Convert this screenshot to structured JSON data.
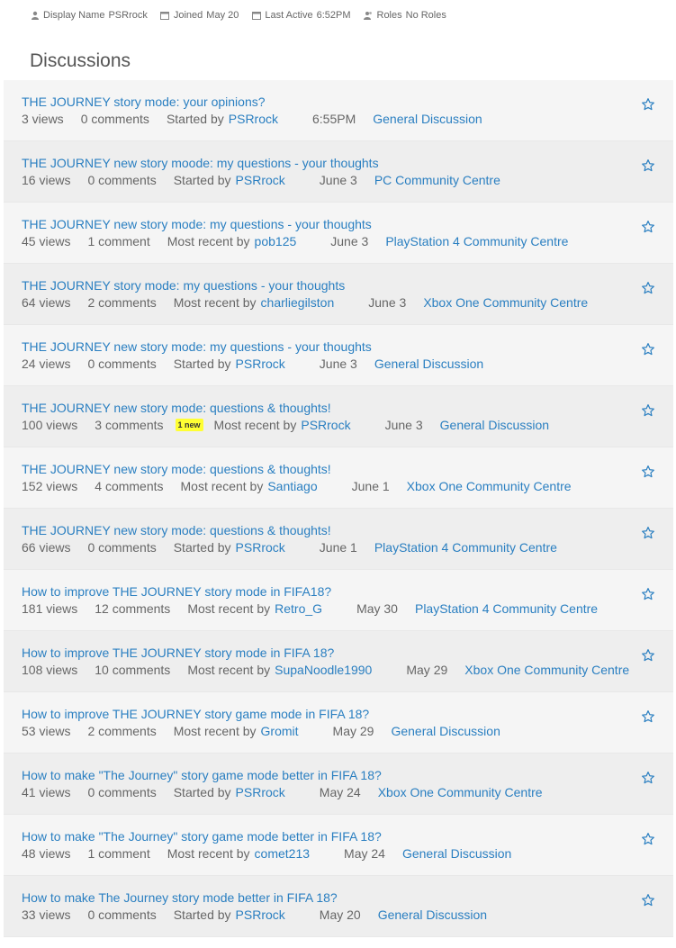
{
  "meta": [
    {
      "key": "Display Name",
      "value": "PSRrock",
      "icon": "user-icon"
    },
    {
      "key": "Joined",
      "value": "May 20",
      "icon": "calendar-icon"
    },
    {
      "key": "Last Active",
      "value": "6:52PM",
      "icon": "calendar-icon"
    },
    {
      "key": "Roles",
      "value": "No Roles",
      "icon": "roles-icon"
    }
  ],
  "section_title": "Discussions",
  "discussions": [
    {
      "title": "THE JOURNEY story mode: your opinions?",
      "views": "3 views",
      "comments": "0 comments",
      "by_label": "Started by",
      "by": "PSRrock",
      "date": "6:55PM",
      "category": "General Discussion",
      "badge": ""
    },
    {
      "title": "THE JOURNEY new story moode: my questions - your thoughts",
      "views": "16 views",
      "comments": "0 comments",
      "by_label": "Started by",
      "by": "PSRrock",
      "date": "June 3",
      "category": "PC Community Centre",
      "badge": ""
    },
    {
      "title": "THE JOURNEY new story mode: my questions - your thoughts",
      "views": "45 views",
      "comments": "1 comment",
      "by_label": "Most recent by",
      "by": "pob125",
      "date": "June 3",
      "category": "PlayStation 4 Community Centre",
      "badge": ""
    },
    {
      "title": "THE JOURNEY story mode: my questions - your thoughts",
      "views": "64 views",
      "comments": "2 comments",
      "by_label": "Most recent by",
      "by": "charliegilston",
      "date": "June 3",
      "category": "Xbox One Community Centre",
      "badge": ""
    },
    {
      "title": "THE JOURNEY new story mode: my questions - your thoughts",
      "views": "24 views",
      "comments": "0 comments",
      "by_label": "Started by",
      "by": "PSRrock",
      "date": "June 3",
      "category": "General Discussion",
      "badge": ""
    },
    {
      "title": "THE JOURNEY new story mode: questions & thoughts!",
      "views": "100 views",
      "comments": "3 comments",
      "by_label": "Most recent by",
      "by": "PSRrock",
      "date": "June 3",
      "category": "General Discussion",
      "badge": "1 new"
    },
    {
      "title": "THE JOURNEY new story mode: questions & thoughts!",
      "views": "152 views",
      "comments": "4 comments",
      "by_label": "Most recent by",
      "by": "Santiago",
      "date": "June 1",
      "category": "Xbox One Community Centre",
      "badge": ""
    },
    {
      "title": "THE JOURNEY new story mode: questions & thoughts!",
      "views": "66 views",
      "comments": "0 comments",
      "by_label": "Started by",
      "by": "PSRrock",
      "date": "June 1",
      "category": "PlayStation 4 Community Centre",
      "badge": ""
    },
    {
      "title": "How to improve THE JOURNEY story mode in FIFA18?",
      "views": "181 views",
      "comments": "12 comments",
      "by_label": "Most recent by",
      "by": "Retro_G",
      "date": "May 30",
      "category": "PlayStation 4 Community Centre",
      "badge": ""
    },
    {
      "title": "How to improve THE JOURNEY story mode in FIFA 18?",
      "views": "108 views",
      "comments": "10 comments",
      "by_label": "Most recent by",
      "by": "SupaNoodle1990",
      "date": "May 29",
      "category": "Xbox One Community Centre",
      "badge": ""
    },
    {
      "title": "How to improve THE JOURNEY story game mode in FIFA 18?",
      "views": "53 views",
      "comments": "2 comments",
      "by_label": "Most recent by",
      "by": "Gromit",
      "date": "May 29",
      "category": "General Discussion",
      "badge": ""
    },
    {
      "title": "How to make \"The Journey\" story game mode better in FIFA 18?",
      "views": "41 views",
      "comments": "0 comments",
      "by_label": "Started by",
      "by": "PSRrock",
      "date": "May 24",
      "category": "Xbox One Community Centre",
      "badge": ""
    },
    {
      "title": "How to make \"The Journey\" story game mode better in FIFA 18?",
      "views": "48 views",
      "comments": "1 comment",
      "by_label": "Most recent by",
      "by": "comet213",
      "date": "May 24",
      "category": "General Discussion",
      "badge": ""
    },
    {
      "title": "How to make The Journey story mode better in FIFA 18?",
      "views": "33 views",
      "comments": "0 comments",
      "by_label": "Started by",
      "by": "PSRrock",
      "date": "May 20",
      "category": "General Discussion",
      "badge": ""
    }
  ],
  "colors": {
    "link": "#2a7fc1",
    "badge": "#ffff33",
    "row_alt": "#eeeeee",
    "row_plain": "#f5f5f5"
  }
}
